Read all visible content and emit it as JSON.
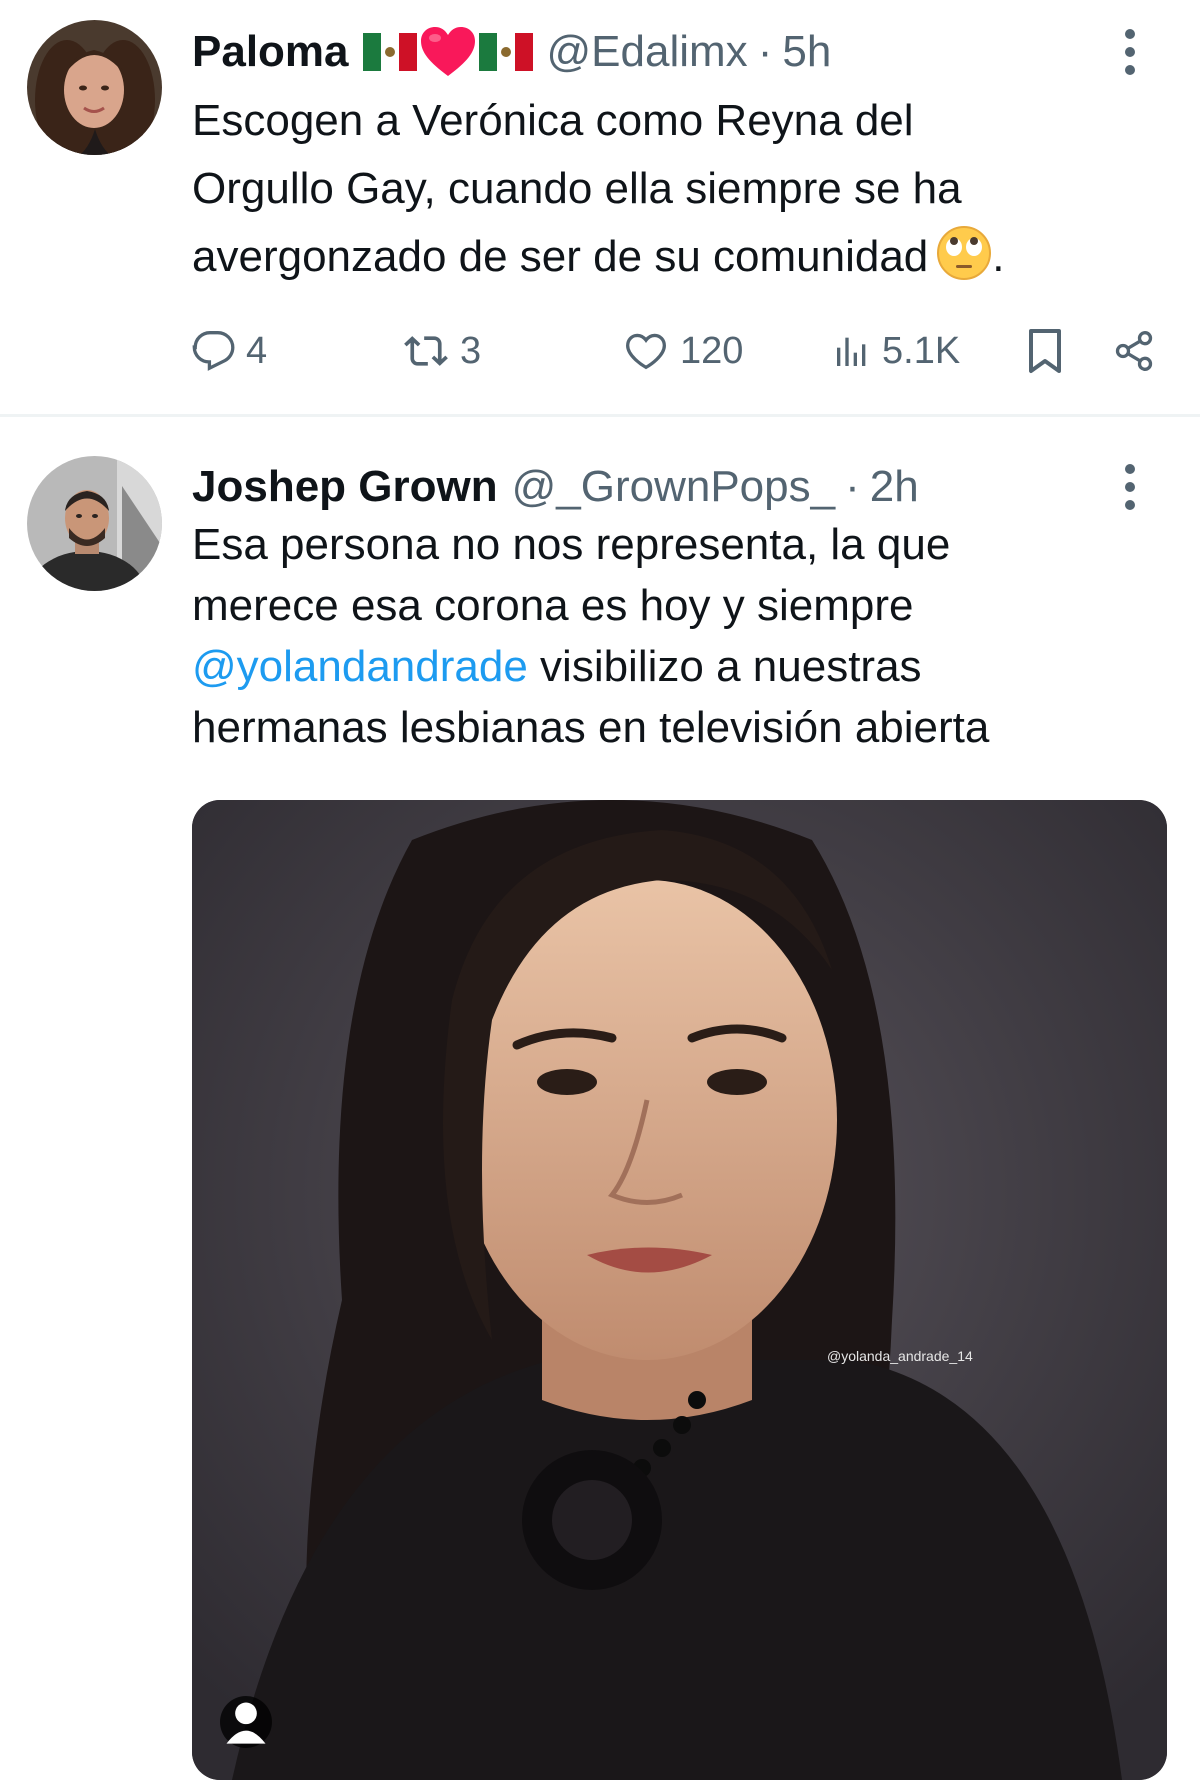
{
  "tweets": [
    {
      "display_name": "Paloma",
      "handle": "@Edalimx",
      "separator": "·",
      "time": "5h",
      "text_lines": [
        "Escogen a Verónica como Reyna del",
        "Orgullo Gay, cuando ella siempre se ha",
        "avergonzado de ser de su comunidad"
      ],
      "text_end": ".",
      "actions": {
        "replies": "4",
        "reposts": "3",
        "likes": "120",
        "views": "5.1K"
      },
      "icons": {
        "flags": "mexico-flag",
        "heart": "red-heart-emoji",
        "emoji": "face-with-rolling-eyes-emoji"
      }
    },
    {
      "display_name": "Joshep Grown",
      "handle": "@_GrownPops_",
      "separator": "·",
      "time": "2h",
      "text_line_1": "Esa persona no nos representa, la que",
      "text_line_2": "merece esa corona es hoy y siempre",
      "mention": "@yolandandrade",
      "text_line_3_rest": " visibilizo a nuestras",
      "text_line_4": "hermanas lesbianas en televisión abierta",
      "media_watermark": "@yolanda_andrade_14"
    }
  ],
  "colors": {
    "text_primary": "#0f1419",
    "text_secondary": "#536471",
    "link": "#1d9bf0",
    "divider": "#eff3f4",
    "heart_red": "#f9185a"
  }
}
